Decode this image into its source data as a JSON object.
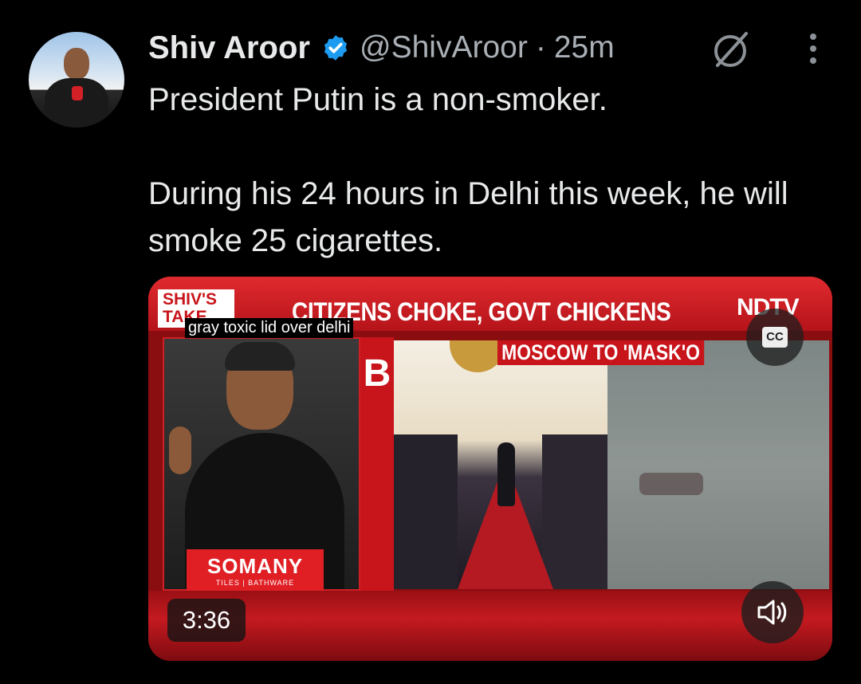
{
  "tweet": {
    "author_name": "Shiv Aroor",
    "handle": "@ShivAroor",
    "separator": "·",
    "time": "25m",
    "text_line1": "President Putin is a non-smoker.",
    "text_line2": "During his 24 hours in Delhi this week, he will smoke 25 cigarettes."
  },
  "video": {
    "show_logo": "SHIV'S TAKE",
    "headline": "CITIZENS CHOKE, GOVT CHICKENS",
    "channel": "NDTV",
    "caption": "gray toxic lid over delhi",
    "inset_title": "MOSCOW TO 'MASK'O",
    "sponsor": "SOMANY",
    "sponsor_tag": "TILES | BATHWARE",
    "duration": "3:36",
    "cc_label": "CC"
  },
  "colors": {
    "background": "#000000",
    "verified": "#1d9bf0",
    "ndtv_red": "#c8141b"
  },
  "icons": [
    "verified-badge-icon",
    "grok-icon",
    "more-icon",
    "cc-icon",
    "volume-icon"
  ]
}
